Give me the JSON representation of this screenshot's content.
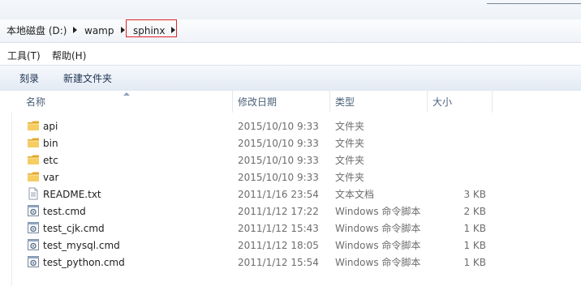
{
  "breadcrumb": {
    "items": [
      "本地磁盘 (D:)",
      "wamp",
      "sphinx"
    ]
  },
  "menu": {
    "items": [
      "工具(T)",
      "帮助(H)"
    ]
  },
  "toolbar": {
    "buttons": [
      "刻录",
      "新建文件夹"
    ]
  },
  "columns": {
    "name": "名称",
    "modified": "修改日期",
    "type": "类型",
    "size": "大小"
  },
  "files": [
    {
      "name": "api",
      "modified": "2015/10/10 9:33",
      "type": "文件夹",
      "size": "",
      "icon": "folder-icon"
    },
    {
      "name": "bin",
      "modified": "2015/10/10 9:33",
      "type": "文件夹",
      "size": "",
      "icon": "folder-icon"
    },
    {
      "name": "etc",
      "modified": "2015/10/10 9:33",
      "type": "文件夹",
      "size": "",
      "icon": "folder-icon"
    },
    {
      "name": "var",
      "modified": "2015/10/10 9:33",
      "type": "文件夹",
      "size": "",
      "icon": "folder-icon"
    },
    {
      "name": "README.txt",
      "modified": "2011/1/16 23:54",
      "type": "文本文档",
      "size": "3 KB",
      "icon": "text-file-icon"
    },
    {
      "name": "test.cmd",
      "modified": "2011/1/12 17:22",
      "type": "Windows 命令脚本",
      "size": "2 KB",
      "icon": "script-file-icon"
    },
    {
      "name": "test_cjk.cmd",
      "modified": "2011/1/12 15:43",
      "type": "Windows 命令脚本",
      "size": "1 KB",
      "icon": "script-file-icon"
    },
    {
      "name": "test_mysql.cmd",
      "modified": "2011/1/12 18:05",
      "type": "Windows 命令脚本",
      "size": "1 KB",
      "icon": "script-file-icon"
    },
    {
      "name": "test_python.cmd",
      "modified": "2011/1/12 15:54",
      "type": "Windows 命令脚本",
      "size": "1 KB",
      "icon": "script-file-icon"
    }
  ],
  "colors": {
    "highlight_border": "#e0232a",
    "folder": "#e8b84a",
    "header_text": "#4c607a"
  }
}
